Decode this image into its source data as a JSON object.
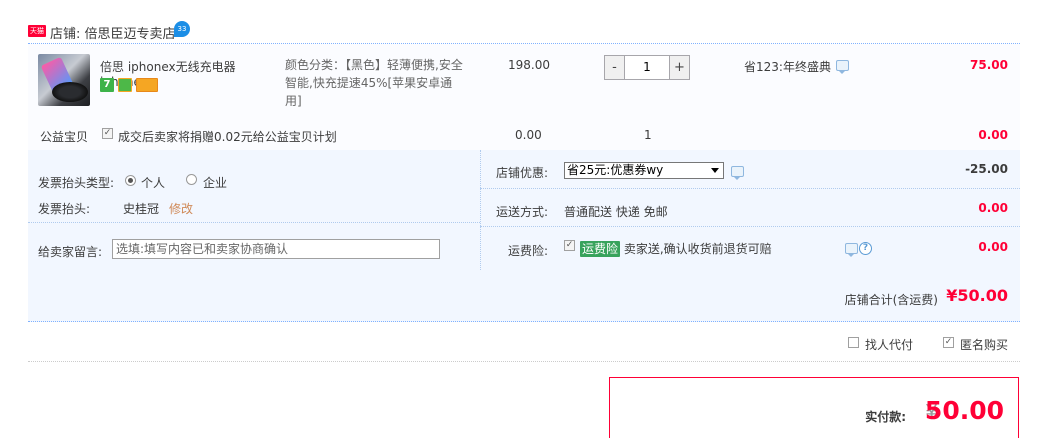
{
  "shop": {
    "badge": "天猫",
    "label": "店铺: 倍思臣迈专卖店",
    "chat_badge": "33"
  },
  "item": {
    "title": "倍思 iphonex无线充电器iphone...",
    "sku": "颜色分类：【黑色】轻薄便携,安全智能,快充提速45%[苹果安卓通用]",
    "unit_price": "198.00",
    "qty_minus": "-",
    "qty_value": "1",
    "qty_plus": "+",
    "promo": "省123:年终盛典",
    "subtotal": "75.00",
    "service_7": "7"
  },
  "charity": {
    "label": "公益宝贝",
    "text": "成交后卖家将捐赠0.02元给公益宝贝计划",
    "price": "0.00",
    "qty": "1",
    "subtotal": "0.00"
  },
  "invoice": {
    "type_label": "发票抬头类型:",
    "opt_personal": "个人",
    "opt_company": "企业",
    "title_label": "发票抬头:",
    "title_value": "史桂冠",
    "edit": "修改"
  },
  "message": {
    "label": "给卖家留言:",
    "placeholder": "选填:填写内容已和卖家协商确认"
  },
  "shop_discount": {
    "label": "店铺优惠:",
    "selected": "省25元:优惠券wy",
    "amount": "-25.00"
  },
  "shipping": {
    "label": "运送方式:",
    "value": "普通配送 快递 免邮",
    "amount": "0.00"
  },
  "insurance": {
    "label": "运费险:",
    "tag": "运费险",
    "text": "卖家送,确认收货前退货可赔",
    "amount": "0.00"
  },
  "shop_total": {
    "label": "店铺合计(含运费)",
    "amount": "¥50.00"
  },
  "extras": {
    "proxy_pay": "找人代付",
    "anonymous": "匿名购买"
  },
  "payment": {
    "label": "实付款:",
    "yen": "¥",
    "amount": "50.00"
  },
  "colors": {
    "accent_red": "#ff0036",
    "panel_blue": "#f2f7ff",
    "dotted_blue": "#80b2ff"
  }
}
